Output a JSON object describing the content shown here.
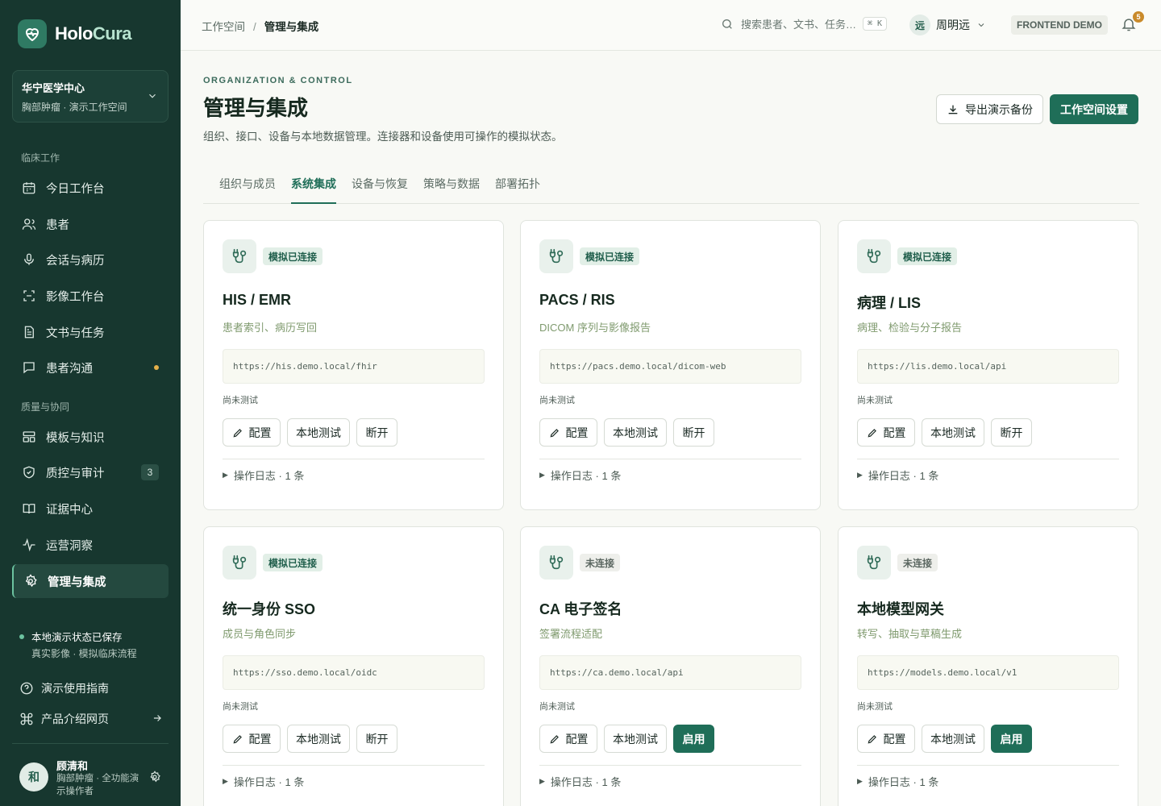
{
  "brand": {
    "name_main": "Holo",
    "name_accent": "Cura"
  },
  "workspace": {
    "name": "华宁医学中心",
    "subtitle": "胸部肿瘤 · 演示工作空间"
  },
  "sidebar": {
    "section_clinical": "临床工作",
    "section_quality": "质量与协同",
    "items": [
      {
        "label": "今日工作台",
        "icon": "calendar-icon"
      },
      {
        "label": "患者",
        "icon": "users-icon"
      },
      {
        "label": "会话与病历",
        "icon": "microphone-icon"
      },
      {
        "label": "影像工作台",
        "icon": "scan-icon"
      },
      {
        "label": "文书与任务",
        "icon": "document-icon"
      },
      {
        "label": "患者沟通",
        "icon": "message-icon"
      },
      {
        "label": "模板与知识",
        "icon": "template-icon"
      },
      {
        "label": "质控与审计",
        "icon": "shield-icon",
        "badge": "3"
      },
      {
        "label": "证据中心",
        "icon": "book-icon"
      },
      {
        "label": "运营洞察",
        "icon": "activity-icon"
      },
      {
        "label": "管理与集成",
        "icon": "gear-icon",
        "active": true
      }
    ],
    "saved_status": "本地演示状态已保存",
    "saved_sub": "真实影像 · 模拟临床流程",
    "guide_link": "演示使用指南",
    "product_link": "产品介绍网页",
    "user": {
      "avatar": "和",
      "name": "顾清和",
      "role": "胸部肿瘤 · 全功能演示操作者"
    }
  },
  "topbar": {
    "crumb_root": "工作空间",
    "crumb_sep": "/",
    "crumb_current": "管理与集成",
    "search_placeholder": "搜索患者、文书、任务…",
    "search_kbd": "⌘ K",
    "user_avatar": "远",
    "user_name": "周明远",
    "demo_tag": "FRONTEND DEMO",
    "notifications": "5"
  },
  "header": {
    "eyebrow": "ORGANIZATION & CONTROL",
    "title": "管理与集成",
    "description": "组织、接口、设备与本地数据管理。连接器和设备使用可操作的模拟状态。",
    "export_button": "导出演示备份",
    "settings_button": "工作空间设置"
  },
  "tabs": [
    "组织与成员",
    "系统集成",
    "设备与恢复",
    "策略与数据",
    "部署拓扑"
  ],
  "active_tab": "系统集成",
  "card_labels": {
    "untested": "尚未测试",
    "configure": "配置",
    "test": "本地测试",
    "disconnect": "断开",
    "enable": "启用",
    "log": "操作日志 · 1 条"
  },
  "connectors": [
    {
      "status": "模拟已连接",
      "connected": true,
      "title": "HIS / EMR",
      "desc": "患者索引、病历写回",
      "url": "https://his.demo.local/fhir"
    },
    {
      "status": "模拟已连接",
      "connected": true,
      "title": "PACS / RIS",
      "desc": "DICOM 序列与影像报告",
      "url": "https://pacs.demo.local/dicom-web"
    },
    {
      "status": "模拟已连接",
      "connected": true,
      "title": "病理 / LIS",
      "desc": "病理、检验与分子报告",
      "url": "https://lis.demo.local/api"
    },
    {
      "status": "模拟已连接",
      "connected": true,
      "title": "统一身份 SSO",
      "desc": "成员与角色同步",
      "url": "https://sso.demo.local/oidc"
    },
    {
      "status": "未连接",
      "connected": false,
      "title": "CA 电子签名",
      "desc": "签署流程适配",
      "url": "https://ca.demo.local/api"
    },
    {
      "status": "未连接",
      "connected": false,
      "title": "本地模型网关",
      "desc": "转写、抽取与草稿生成",
      "url": "https://models.demo.local/v1"
    }
  ],
  "colors": {
    "sidebar": "#17372f",
    "accent": "#1f6e58",
    "background": "#f8f9f5"
  }
}
